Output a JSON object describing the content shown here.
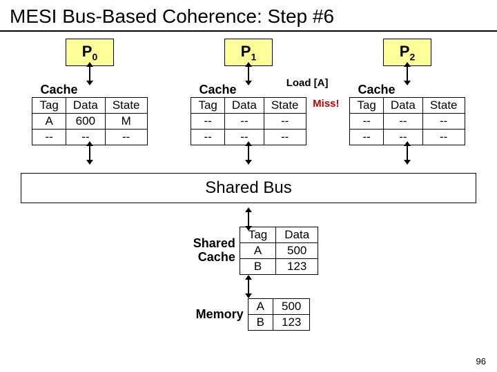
{
  "title": "MESI Bus-Based Coherence: Step #6",
  "procs": [
    "P",
    "P",
    "P"
  ],
  "proc_idx": [
    "0",
    "1",
    "2"
  ],
  "cache_label": "Cache",
  "headers": [
    "Tag",
    "Data",
    "State"
  ],
  "p0": {
    "rows": [
      [
        "A",
        "600",
        "M"
      ],
      [
        "--",
        "--",
        "--"
      ]
    ]
  },
  "p1": {
    "rows": [
      [
        "--",
        "--",
        "--"
      ],
      [
        "--",
        "--",
        "--"
      ]
    ],
    "load": "Load [A]",
    "miss": "Miss!"
  },
  "p2": {
    "rows": [
      [
        "--",
        "--",
        "--"
      ],
      [
        "--",
        "--",
        "--"
      ]
    ]
  },
  "shared_bus": "Shared Bus",
  "shared_cache_label": "Shared Cache",
  "memory_label": "Memory",
  "shared_cache": {
    "headers": [
      "Tag",
      "Data"
    ],
    "rows": [
      [
        "A",
        "500"
      ],
      [
        "B",
        "123"
      ]
    ]
  },
  "memory": {
    "rows": [
      [
        "A",
        "500"
      ],
      [
        "B",
        "123"
      ]
    ]
  },
  "page": "96"
}
